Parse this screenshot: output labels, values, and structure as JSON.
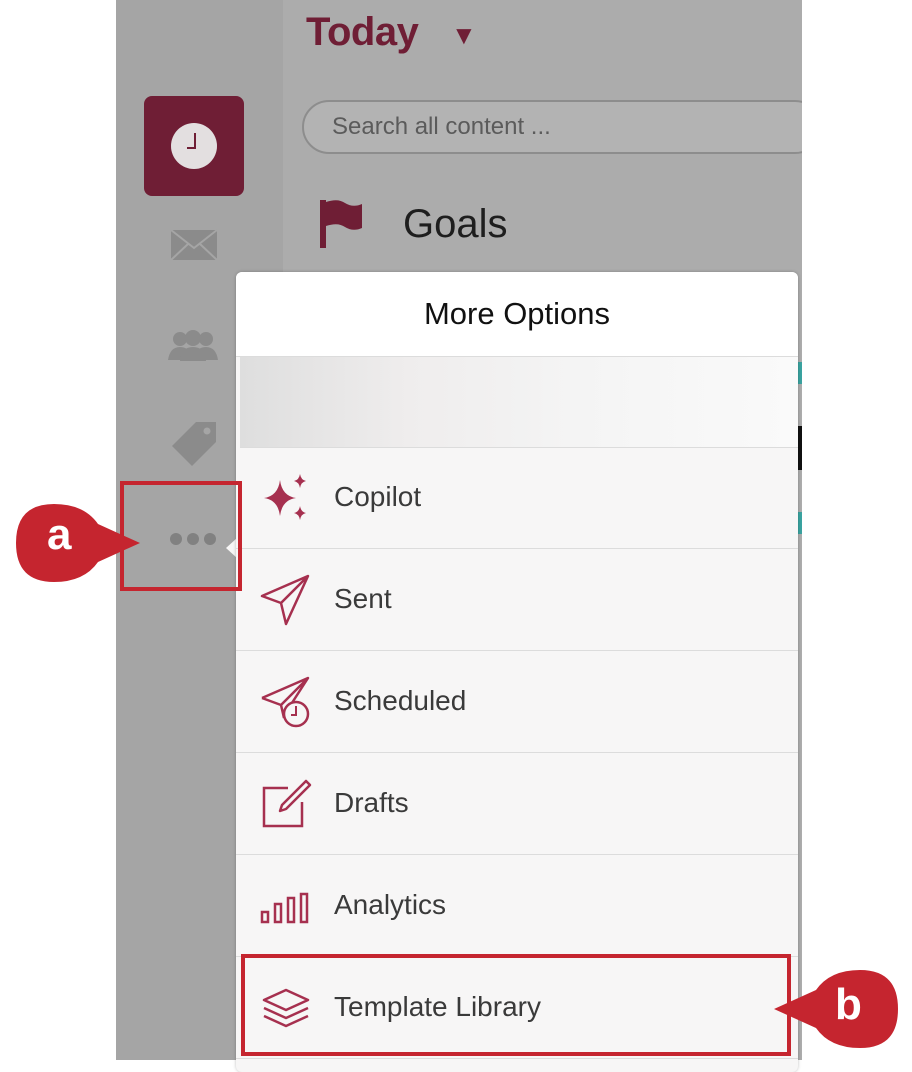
{
  "header": {
    "title": "Today",
    "caret": "▼"
  },
  "search": {
    "placeholder": "Search all content ..."
  },
  "goals": {
    "title": "Goals",
    "icon": "flag-icon"
  },
  "sidebar": {
    "items": [
      {
        "icon": "clock-icon",
        "active": true
      },
      {
        "icon": "mail-icon"
      },
      {
        "icon": "people-icon"
      },
      {
        "icon": "tag-icon"
      },
      {
        "icon": "more-icon"
      }
    ]
  },
  "popover": {
    "title": "More Options",
    "items": [
      {
        "label": "Copilot",
        "icon": "sparkle-icon"
      },
      {
        "label": "Sent",
        "icon": "paper-plane-icon"
      },
      {
        "label": "Scheduled",
        "icon": "scheduled-plane-icon"
      },
      {
        "label": "Drafts",
        "icon": "compose-icon"
      },
      {
        "label": "Analytics",
        "icon": "bar-chart-icon"
      },
      {
        "label": "Template Library",
        "icon": "layers-icon"
      }
    ]
  },
  "annotations": {
    "a": "a",
    "b": "b"
  },
  "colors": {
    "brand": "#6f1e35",
    "accent": "#a6304f",
    "highlight": "#c5252f"
  }
}
